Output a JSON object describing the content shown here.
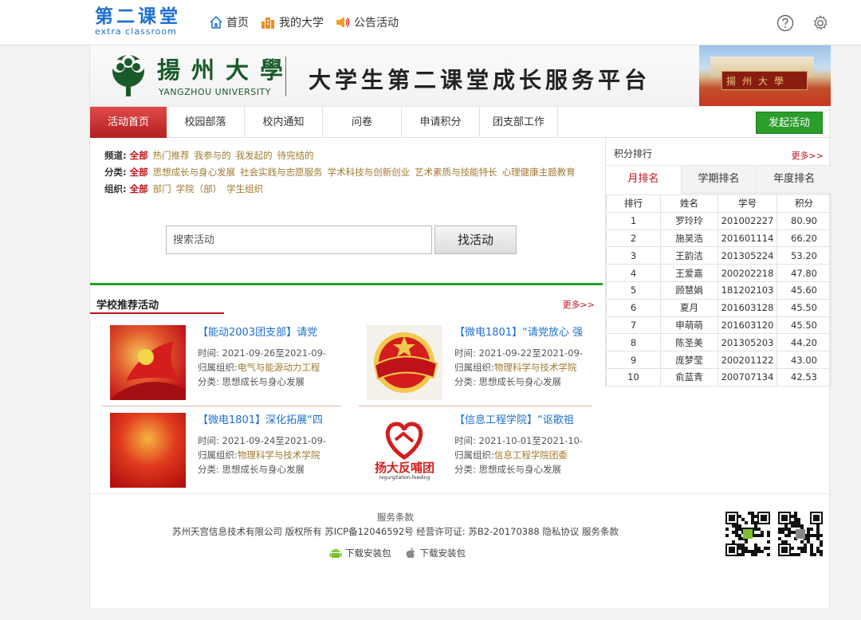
{
  "header": {
    "logo_cn": "第二课堂",
    "logo_en": "extra classroom",
    "nav": [
      {
        "label": "首页",
        "icon": "home-icon"
      },
      {
        "label": "我的大学",
        "icon": "building-icon"
      },
      {
        "label": "公告活动",
        "icon": "megaphone-icon"
      }
    ],
    "icons": [
      "help-icon",
      "settings-icon"
    ]
  },
  "banner": {
    "university": "揚州大學",
    "university_en": "YANGZHOU UNIVERSITY",
    "platform": "大学生第二课堂成长服务平台",
    "gate_text": "揚州大學"
  },
  "navbar": {
    "tabs": [
      "活动首页",
      "校园部落",
      "校内通知",
      "问卷",
      "申请积分",
      "团支部工作"
    ],
    "active_tab": "活动首页",
    "launch_button": "发起活动"
  },
  "filters": {
    "channel": {
      "label": "频道:",
      "all": "全部",
      "options": [
        "热门推荐",
        "我参与的",
        "我发起的",
        "待完结的"
      ]
    },
    "category": {
      "label": "分类:",
      "all": "全部",
      "options": [
        "思想成长与身心发展",
        "社会实践与志愿服务",
        "学术科技与创新创业",
        "艺术素质与技能特长",
        "心理健康主题教育"
      ]
    },
    "org": {
      "label": "组织:",
      "all": "全部",
      "options": [
        "部门",
        "学院（部）",
        "学生组织"
      ]
    }
  },
  "search": {
    "placeholder": "搜索活动",
    "button": "找活动"
  },
  "recommended": {
    "title": "学校推荐活动",
    "more": "更多>>",
    "time_label": "时间:",
    "org_label": "归属组织:",
    "cat_label": "分类:",
    "items": [
      {
        "title": "【能动2003团支部】请党",
        "time": "2021-09-26至2021-09-",
        "org": "电气与能源动力工程",
        "category": "思想成长与身心发展",
        "thumb": "party-flag-image"
      },
      {
        "title": "【微电1801】“请党放心 强",
        "time": "2021-09-22至2021-09-",
        "org": "物理科学与技术学院",
        "category": "思想成长与身心发展",
        "thumb": "youth-league-badge-image"
      },
      {
        "title": "【微电1801】深化拓展“四",
        "time": "2021-09-24至2021-09-",
        "org": "物理科学与技术学院",
        "category": "思想成长与身心发展",
        "thumb": "red-background-image"
      },
      {
        "title": "【信息工程学院】“讴歌祖",
        "time": "2021-10-01至2021-10-",
        "org": "信息工程学院团委",
        "category": "思想成长与身心发展",
        "thumb": "heart-logo-image",
        "thumb_text": "扬大反哺团",
        "thumb_subtext": "regurgitation-feeding"
      }
    ]
  },
  "ranking": {
    "title": "积分排行",
    "more": "更多>>",
    "tabs": [
      "月排名",
      "学期排名",
      "年度排名"
    ],
    "active_tab": "月排名",
    "columns": [
      "排行",
      "姓名",
      "学号",
      "积分"
    ],
    "rows": [
      [
        "1",
        "罗玲玲",
        "201002227",
        "80.90"
      ],
      [
        "2",
        "施昊浩",
        "201601114",
        "66.20"
      ],
      [
        "3",
        "王韵洁",
        "201305224",
        "53.20"
      ],
      [
        "4",
        "王爱嘉",
        "200202218",
        "47.80"
      ],
      [
        "5",
        "顾慧娟",
        "181202103",
        "45.60"
      ],
      [
        "6",
        "夏月",
        "201603128",
        "45.50"
      ],
      [
        "7",
        "申萌萌",
        "201603120",
        "45.50"
      ],
      [
        "8",
        "陈圣美",
        "201305203",
        "44.20"
      ],
      [
        "9",
        "庞梦莹",
        "200201122",
        "43.00"
      ],
      [
        "10",
        "俞蓝青",
        "200707134",
        "42.53"
      ]
    ]
  },
  "footer": {
    "terms": "服务条款",
    "company": "苏州天宫信息技术有限公司 版权所有 苏ICP备12046592号 经营许可证:  苏B2-20170388 隐私协议 服务条款",
    "downloads": [
      {
        "label": "下载安装包",
        "icon": "android-icon"
      },
      {
        "label": "下载安装包",
        "icon": "apple-icon"
      }
    ],
    "qr_codes": [
      "android-qr-code",
      "ios-qr-code"
    ]
  },
  "colors": {
    "brand_blue": "#1e6fcf",
    "accent_red": "#c0121b",
    "accent_green": "#2a9d2a",
    "link_gold": "#a0792f"
  }
}
